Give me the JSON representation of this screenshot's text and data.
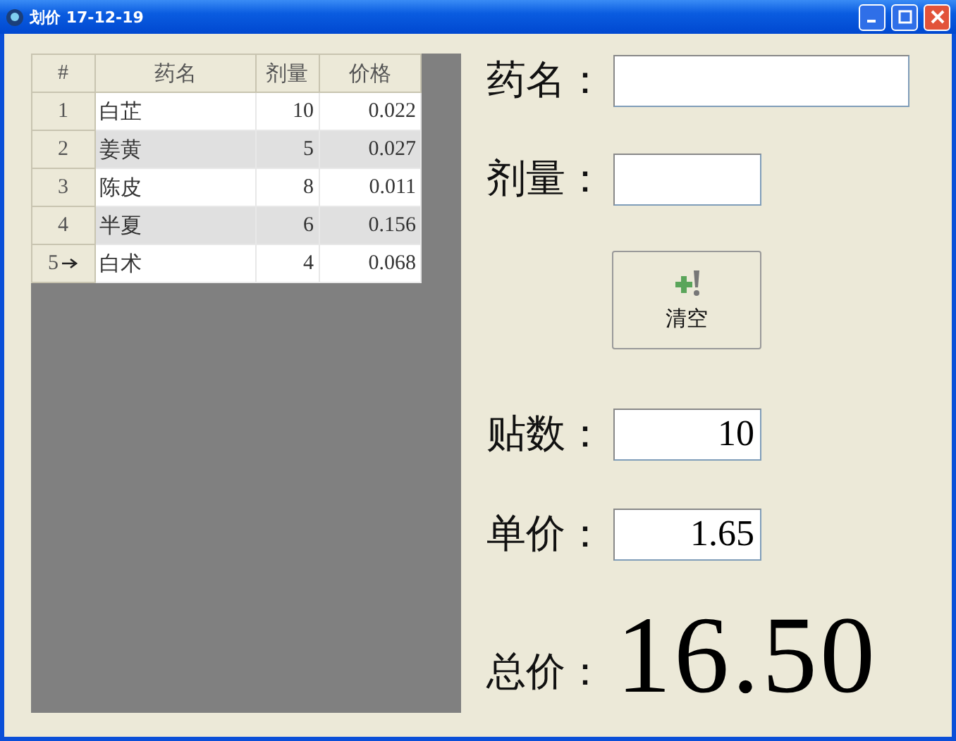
{
  "window": {
    "title": "划价 17-12-19"
  },
  "table": {
    "columns": [
      "#",
      "药名",
      "剂量",
      "价格"
    ],
    "rows": [
      {
        "number": "1",
        "name": "白芷",
        "dose": "10",
        "price": "0.022",
        "current": false
      },
      {
        "number": "2",
        "name": "姜黄",
        "dose": "5",
        "price": "0.027",
        "current": false
      },
      {
        "number": "3",
        "name": "陈皮",
        "dose": "8",
        "price": "0.011",
        "current": false
      },
      {
        "number": "4",
        "name": "半夏",
        "dose": "6",
        "price": "0.156",
        "current": false
      },
      {
        "number": "5",
        "name": "白术",
        "dose": "4",
        "price": "0.068",
        "current": true
      }
    ]
  },
  "form": {
    "name_label": "药名：",
    "dose_label": "剂量：",
    "clear_button": "清空",
    "count_label": "贴数：",
    "count_value": "10",
    "unit_price_label": "单价：",
    "unit_price_value": "1.65",
    "total_label": "总价：",
    "total_value": "16.50"
  }
}
